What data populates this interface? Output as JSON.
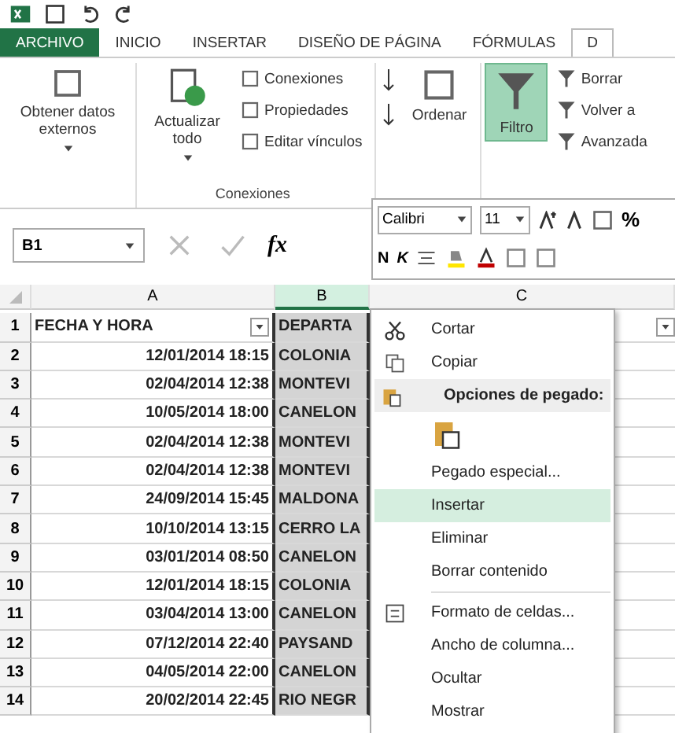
{
  "tabs": [
    {
      "label": "ARCHIVO",
      "kind": "file",
      "selected": false
    },
    {
      "label": "INICIO",
      "kind": "tab",
      "selected": false
    },
    {
      "label": "INSERTAR",
      "kind": "tab",
      "selected": false
    },
    {
      "label": "DISEÑO DE PÁGINA",
      "kind": "tab",
      "selected": false
    },
    {
      "label": "FÓRMULAS",
      "kind": "tab",
      "selected": false
    },
    {
      "label": "D",
      "kind": "tab",
      "selected": true
    }
  ],
  "ribbon": {
    "external": "Obtener datos externos",
    "refresh": "Actualizar todo",
    "connections": [
      "Conexiones",
      "Propiedades",
      "Editar vínculos"
    ],
    "connections_group": "Conexiones",
    "sort": "Ordenar",
    "filter": {
      "label": "Filtro",
      "on": true
    },
    "filter_actions": [
      "Borrar",
      "Volver a",
      "Avanzada"
    ]
  },
  "mini_toolbar": {
    "font": "Calibri",
    "size": "11",
    "percent": "%",
    "bold": "N",
    "italic": "K"
  },
  "formula_bar": {
    "name_box": "B1",
    "fx": "fx"
  },
  "columns": [
    {
      "label": "A",
      "selected": false
    },
    {
      "label": "B",
      "selected": true
    },
    {
      "label": "C",
      "selected": false
    }
  ],
  "rows": [
    {
      "n": "1",
      "a": "FECHA Y HORA",
      "b": "DEPARTA",
      "header": true
    },
    {
      "n": "2",
      "a": "12/01/2014 18:15",
      "b": "COLONIA",
      "header": false
    },
    {
      "n": "3",
      "a": "02/04/2014 12:38",
      "b": "MONTEVI",
      "header": false
    },
    {
      "n": "4",
      "a": "10/05/2014 18:00",
      "b": "CANELON",
      "header": false
    },
    {
      "n": "5",
      "a": "02/04/2014 12:38",
      "b": "MONTEVI",
      "header": false
    },
    {
      "n": "6",
      "a": "02/04/2014 12:38",
      "b": "MONTEVI",
      "header": false
    },
    {
      "n": "7",
      "a": "24/09/2014 15:45",
      "b": "MALDONA",
      "header": false
    },
    {
      "n": "8",
      "a": "10/10/2014 13:15",
      "b": "CERRO LA",
      "header": false
    },
    {
      "n": "9",
      "a": "03/01/2014 08:50",
      "b": "CANELON",
      "header": false
    },
    {
      "n": "10",
      "a": "12/01/2014 18:15",
      "b": "COLONIA",
      "header": false
    },
    {
      "n": "11",
      "a": "03/04/2014 13:00",
      "b": "CANELON",
      "header": false
    },
    {
      "n": "12",
      "a": "07/12/2014 22:40",
      "b": "PAYSAND",
      "header": false
    },
    {
      "n": "13",
      "a": "04/05/2014 22:00",
      "b": "CANELON",
      "header": false
    },
    {
      "n": "14",
      "a": "20/02/2014 22:45",
      "b": "RIO NEGR",
      "header": false
    }
  ],
  "context_menu": [
    {
      "kind": "cut",
      "label": "Cortar",
      "selected": false
    },
    {
      "kind": "copy",
      "label": "Copiar",
      "selected": false
    },
    {
      "kind": "heading",
      "label": "Opciones de pegado:",
      "selected": false
    },
    {
      "kind": "paste",
      "selected": false
    },
    {
      "kind": "item",
      "label": "Pegado especial...",
      "selected": false
    },
    {
      "kind": "item",
      "label": "Insertar",
      "selected": true
    },
    {
      "kind": "item",
      "label": "Eliminar",
      "selected": false
    },
    {
      "kind": "item",
      "label": "Borrar contenido",
      "selected": false
    },
    {
      "kind": "separator"
    },
    {
      "kind": "format",
      "label": "Formato de celdas...",
      "selected": false
    },
    {
      "kind": "item",
      "label": "Ancho de columna...",
      "selected": false
    },
    {
      "kind": "item",
      "label": "Ocultar",
      "selected": false
    },
    {
      "kind": "item",
      "label": "Mostrar",
      "selected": false
    }
  ]
}
